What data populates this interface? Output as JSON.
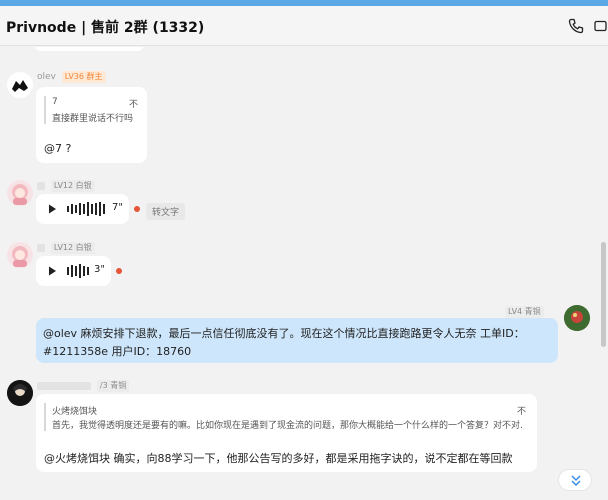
{
  "header": {
    "title": "Privnode | 售前 2群 (1332)"
  },
  "icons": {
    "call": "phone-icon",
    "video": "video-icon",
    "play": "play-icon",
    "scroll_down": "chevron-double-down-icon"
  },
  "colors": {
    "accent": "#5aa9e6",
    "own_bubble": "#cde6fb",
    "unread_dot": "#e8533a",
    "owner_badge": "#f2873b"
  },
  "messages": [
    {
      "sender": "olev",
      "badge": "LV36 群主",
      "quote_author": "7",
      "quote_close": "不",
      "quote_text": "直接群里说话不行吗",
      "text": "@7 ?"
    },
    {
      "badge": "LV12 白银",
      "duration": "7\"",
      "transcribe": "转文字"
    },
    {
      "badge": "LV12 白银",
      "duration": "3\""
    },
    {
      "badge": "LV4 青铜",
      "line1": "@olev  麻烦安排下退款，最后一点信任彻底没有了。现在这个情况比直接跑路更令人无奈     工单ID：",
      "line2": "#1211358e    用户ID：18760"
    },
    {
      "badge": "/3 青铜",
      "quote_author": "火烤烧饵块",
      "quote_close": "不",
      "quote_text": "首先，我觉得透明度还是要有的嘛。比如你现在是遇到了现金流的问题，那你大概能给一个什么样的一个答复？对不对...",
      "text": "@火烤烧饵块 确实，向88学习一下，他那公告写的多好，都是采用拖字诀的，说不定都在等回款"
    }
  ]
}
